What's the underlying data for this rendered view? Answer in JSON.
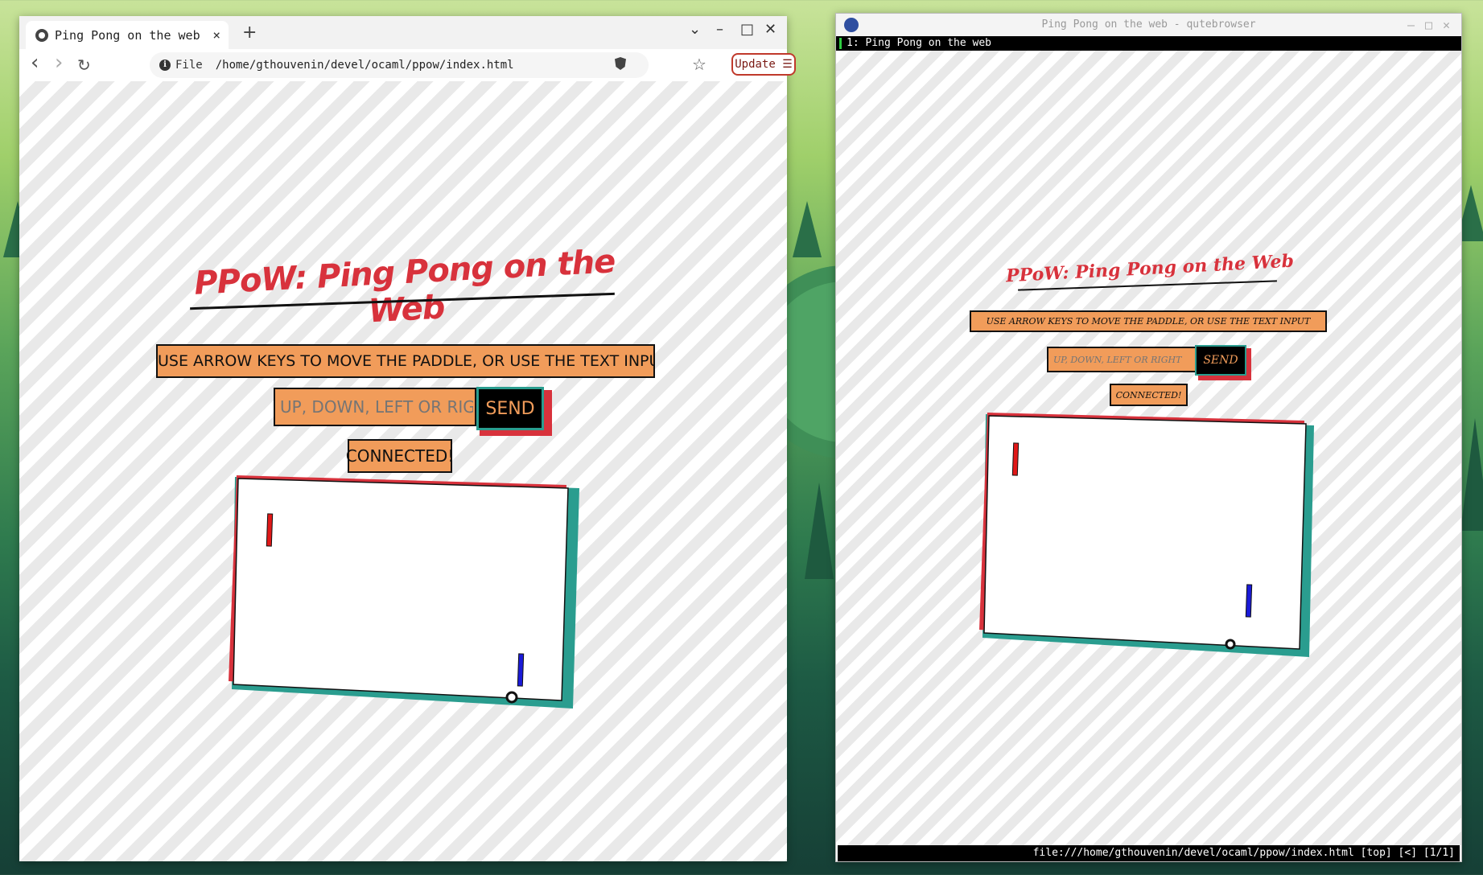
{
  "left_browser": {
    "tab_title": "Ping Pong on the web",
    "tab_close": "×",
    "new_tab": "+",
    "window_controls": {
      "dropdown": "⌄",
      "minimize": "–",
      "maximize": "□",
      "close": "✕"
    },
    "nav": {
      "back": "‹",
      "forward": "›",
      "reload": "↻"
    },
    "address": {
      "scheme_label": "File",
      "url": "/home/gthouvenin/devel/ocaml/ppow/index.html"
    },
    "bookmark_icon": "☆",
    "update_label": "Update ☰"
  },
  "right_browser": {
    "window_title": "Ping Pong on the web - qutebrowser",
    "window_controls": {
      "minimize": "–",
      "maximize": "□",
      "close": "✕"
    },
    "tab_label": "1: Ping Pong on the web",
    "statusbar": "file:///home/gthouvenin/devel/ocaml/ppow/index.html [top] [<] [1/1]"
  },
  "app": {
    "title": "PPoW: Ping Pong on the Web",
    "instructions": "USE ARROW KEYS TO MOVE THE PADDLE, OR USE THE TEXT INPUT",
    "input_placeholder": "UP, DOWN, LEFT OR RIGHT",
    "send_label": "SEND",
    "status": "CONNECTED!"
  },
  "colors": {
    "accent_red": "#d8323c",
    "panel_orange": "#f19c5a",
    "teal_shadow": "#2a9d8f",
    "paddle_left": "#e01818",
    "paddle_right": "#1a1ad8"
  }
}
